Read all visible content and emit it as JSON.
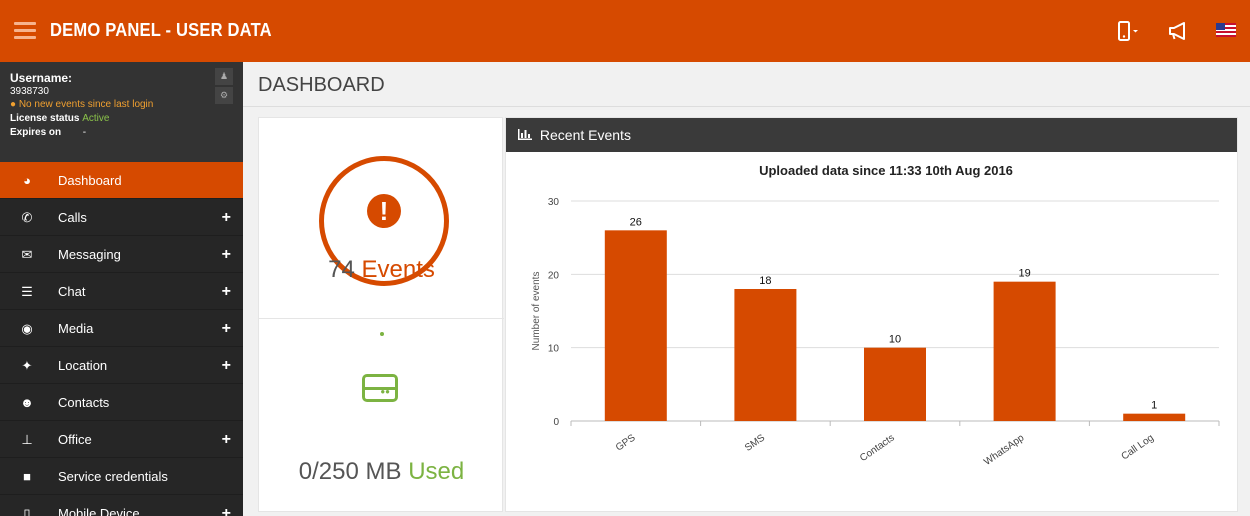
{
  "header": {
    "brand": "DEMO PANEL - USER DATA",
    "icons": [
      "menu-icon",
      "mobile-device-icon",
      "megaphone-icon",
      "us-flag-icon"
    ]
  },
  "user": {
    "username_label": "Username:",
    "username": "3938730",
    "notice": "No new events since last login",
    "license_label": "License status",
    "license_value": "Active",
    "expires_label": "Expires on",
    "expires_value": "-"
  },
  "sidebar": {
    "items": [
      {
        "label": "Dashboard",
        "icon": "dashboard-icon",
        "expandable": false,
        "active": true
      },
      {
        "label": "Calls",
        "icon": "phone-icon",
        "expandable": true
      },
      {
        "label": "Messaging",
        "icon": "envelope-icon",
        "expandable": true
      },
      {
        "label": "Chat",
        "icon": "list-icon",
        "expandable": true
      },
      {
        "label": "Media",
        "icon": "camera-icon",
        "expandable": true
      },
      {
        "label": "Location",
        "icon": "crosshair-icon",
        "expandable": true
      },
      {
        "label": "Contacts",
        "icon": "users-icon",
        "expandable": false
      },
      {
        "label": "Office",
        "icon": "pin-icon",
        "expandable": true
      },
      {
        "label": "Service credentials",
        "icon": "lock-icon",
        "expandable": false
      },
      {
        "label": "Mobile Device",
        "icon": "mobile-icon",
        "expandable": true
      }
    ]
  },
  "main": {
    "title": "DASHBOARD",
    "events_count": "74",
    "events_label": "Events",
    "storage_value": "0/250 MB",
    "storage_label": "Used",
    "panel_title": "Recent Events"
  },
  "colors": {
    "accent": "#d64a00",
    "green": "#7cb342",
    "sidebar": "#262626",
    "panel_header": "#3a3a3a"
  },
  "chart_data": {
    "type": "bar",
    "title": "Uploaded data since 11:33 10th Aug 2016",
    "xlabel": "",
    "ylabel": "Number of events",
    "categories": [
      "GPS",
      "SMS",
      "Contacts",
      "WhatsApp",
      "Call Log"
    ],
    "values": [
      26,
      18,
      10,
      19,
      1
    ],
    "ylim": [
      0,
      30
    ],
    "yticks": [
      0,
      10,
      20,
      30
    ],
    "grid": true,
    "data_labels": true,
    "color": "#d64a00"
  }
}
